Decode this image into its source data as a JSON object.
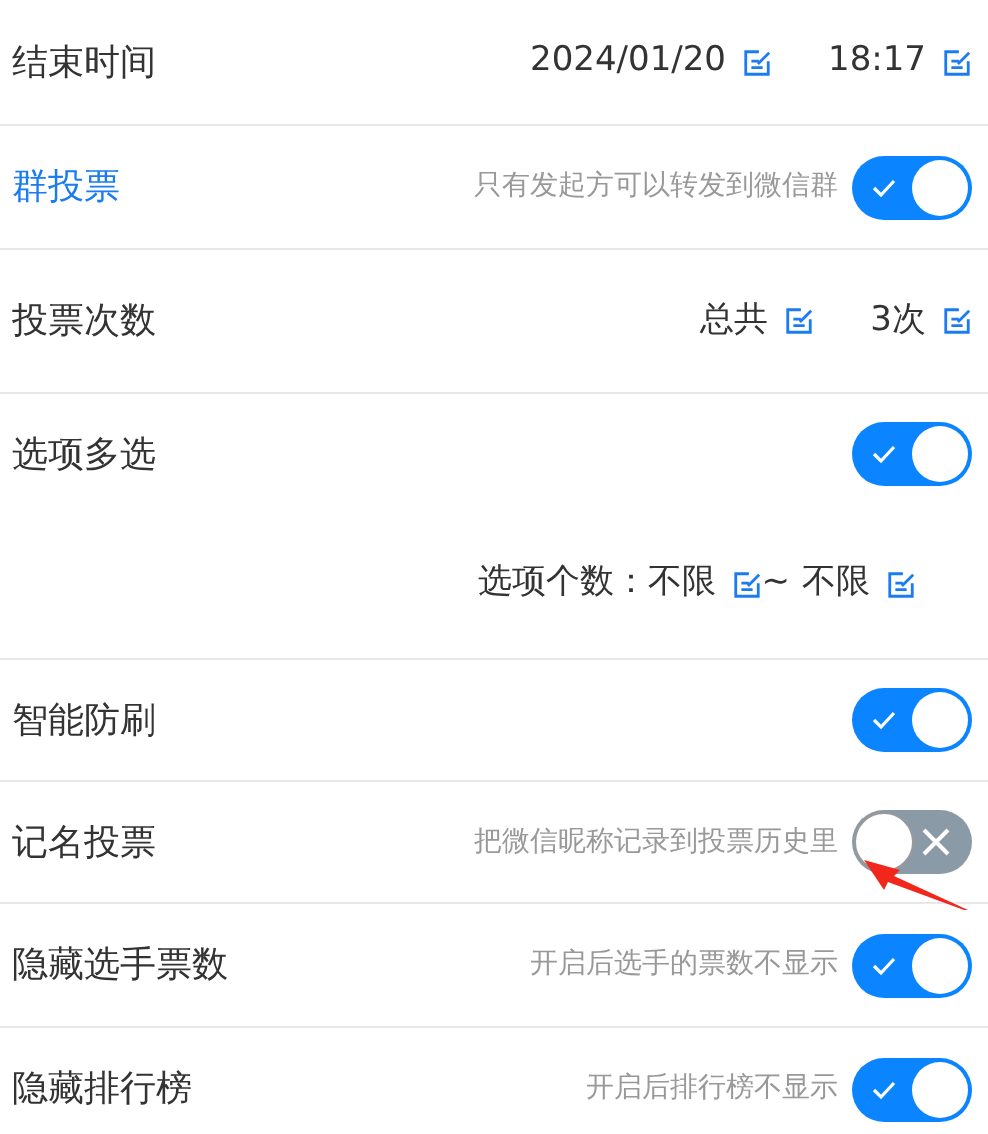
{
  "rows": [
    {
      "kind": "values",
      "title": "结束时间",
      "accent": false,
      "values": [
        "2024/01/20",
        "18:17"
      ]
    },
    {
      "kind": "toggle",
      "title": "群投票",
      "accent": true,
      "hint": "只有发起方可以转发到微信群",
      "on": true
    },
    {
      "kind": "values",
      "title": "投票次数",
      "accent": false,
      "values": [
        "总共",
        "3次"
      ]
    },
    {
      "kind": "toggle",
      "title": "选项多选",
      "accent": false,
      "on": true,
      "sub": {
        "label": "选项个数：",
        "values": [
          "不限",
          "不限"
        ],
        "separator": "~"
      }
    },
    {
      "kind": "toggle",
      "title": "智能防刷",
      "accent": false,
      "on": true
    },
    {
      "kind": "toggle",
      "title": "记名投票",
      "accent": false,
      "hint": "把微信昵称记录到投票历史里",
      "on": false,
      "pointer": true
    },
    {
      "kind": "toggle",
      "title": "隐藏选手票数",
      "accent": false,
      "hint": "开启后选手的票数不显示",
      "on": true
    },
    {
      "kind": "toggle",
      "title": "隐藏排行榜",
      "accent": false,
      "hint": "开启后排行榜不显示",
      "on": true
    }
  ]
}
